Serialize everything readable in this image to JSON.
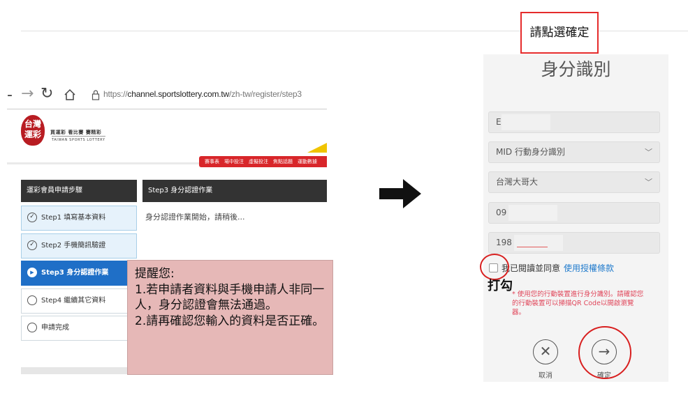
{
  "browser": {
    "url_prefix": "https://",
    "url_host": "channel.sportslottery.com.tw",
    "url_path": "/zh-tw/register/step3",
    "icons": [
      "arrow-right-icon",
      "refresh-icon",
      "home-icon",
      "lock-icon"
    ]
  },
  "site": {
    "logo_text": "台灣\n運彩",
    "brand_top": "買運彩  看比賽  賽精彩",
    "brand_en": "TAIWAN SPORTS LOTTERY",
    "menu": [
      "賽事表",
      "場中投注",
      "虛擬投注",
      "焦點話題",
      "運動數據"
    ]
  },
  "sidebar": {
    "header": "運彩會員申請步驟",
    "steps": [
      {
        "label": "Step1 填寫基本資料",
        "state": "done"
      },
      {
        "label": "Step2 手機簡訊驗證",
        "state": "done"
      },
      {
        "label": "Step3 身分認證作業",
        "state": "active"
      },
      {
        "label": "Step4 繼續其它資料",
        "state": "todo"
      },
      {
        "label": "申請完成",
        "state": "todo"
      }
    ]
  },
  "main": {
    "header": "Step3 身分認證作業",
    "body": "身分認證作業開始，請稍後..."
  },
  "reminder": {
    "title": "提醒您:",
    "item1": "1.若申請者資料與手機申請人非同一人，身分認證會無法通過。",
    "item2": "2.請再確認您輸入的資料是否正確。"
  },
  "annotation": {
    "confirm_hint": "請點選確定",
    "tick_hint": "打勾"
  },
  "id_panel": {
    "title": "身分識別",
    "id_value": "E",
    "method_select": "MID 行動身分識別",
    "carrier_select": "台灣大哥大",
    "phone_value": "09",
    "birth_value": "198",
    "agree_text": "我已閱讀並同意",
    "agree_link": "使用授權條款",
    "notice": "* 使用您的行動裝置進行身分識別。請確認您的行動裝置可以掃描QR Code以開啟瀏覽器。",
    "cancel_label": "取消",
    "confirm_label": "確定"
  },
  "colors": {
    "accent_red": "#e52b2b",
    "step_active": "#1f6fc7",
    "reminder_bg": "#e6b8b7",
    "link_blue": "#1f7acc"
  }
}
